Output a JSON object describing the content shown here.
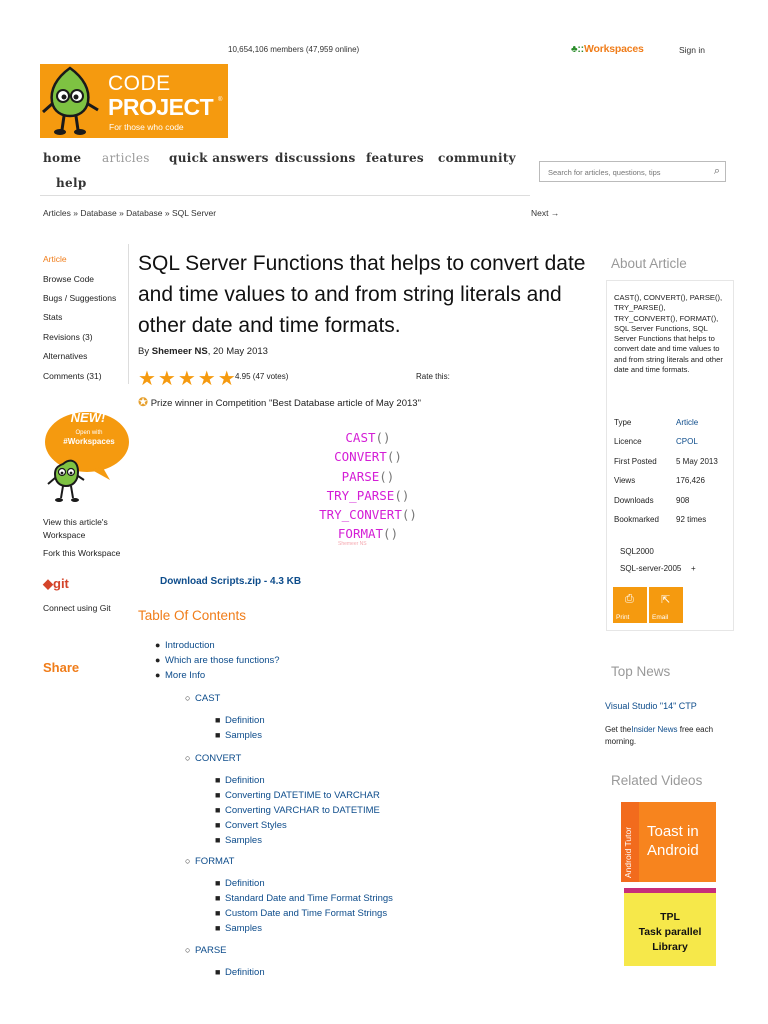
{
  "topbar": {
    "members": "10,654,106 members (47,959 online)",
    "workspaces": "Workspaces",
    "signin": "Sign in"
  },
  "logo": {
    "line1": "CODE",
    "line2": "PROJECT",
    "reg": "®",
    "tagline": "For those who code"
  },
  "nav": {
    "items": [
      "home",
      "articles",
      "quick answers",
      "discussions",
      "features",
      "community",
      "help"
    ]
  },
  "search": {
    "placeholder": "Search for articles, questions, tips"
  },
  "breadcrumb": {
    "text": "Articles » Database » Database » SQL Server",
    "next": "Next →"
  },
  "leftnav": {
    "items": [
      "Article",
      "Browse Code",
      "Bugs / Suggestions",
      "Stats",
      "Revisions (3)",
      "Alternatives",
      "Comments (31)"
    ],
    "ws_badge_new": "NEW!",
    "ws_badge_open": "Open with",
    "ws_badge_name": "#Workspaces",
    "view_ws_1": "View this article's",
    "view_ws_2": "Workspace",
    "fork_ws": "Fork this Workspace",
    "git": "git",
    "connect_git": "Connect using Git",
    "share": "Share"
  },
  "article": {
    "title": "SQL Server Functions that helps to convert date and time values to and from string literals and other date and time formats.",
    "by": "By",
    "author": "Shemeer NS",
    "date": ", 20 May 2013",
    "stars": "★★★★★",
    "rating": "4.95 (47 votes)",
    "rate_this": "Rate this:",
    "prize": "Prize winner in Competition \"Best Database article of May 2013\"",
    "functions": [
      "CAST",
      "CONVERT",
      "PARSE",
      "TRY_PARSE",
      "TRY_CONVERT",
      "FORMAT"
    ],
    "paren": "()",
    "watermark": "Shemeer NS",
    "download": "Download Scripts.zip - 4.3 KB",
    "toc_title": "Table Of Contents",
    "toc": {
      "l1": [
        "Introduction",
        "Which are those functions?",
        "More Info"
      ],
      "cast": "CAST",
      "cast_items": [
        "Definition",
        "Samples"
      ],
      "convert": "CONVERT",
      "convert_items": [
        "Definition",
        "Converting DATETIME to VARCHAR",
        "Converting VARCHAR to DATETIME",
        "Convert Styles",
        "Samples"
      ],
      "format": "FORMAT",
      "format_items": [
        "Definition",
        "Standard Date and Time Format Strings",
        "Custom Date and Time Format Strings",
        "Samples"
      ],
      "parse": "PARSE",
      "parse_items": [
        "Definition"
      ]
    }
  },
  "about": {
    "heading": "About Article",
    "description": "CAST(), CONVERT(), PARSE(), TRY_PARSE(), TRY_CONVERT(), FORMAT(), SQL Server Functions, SQL Server Functions that helps to convert date and time values to and from string literals and other date and time formats.",
    "meta": [
      {
        "k": "Type",
        "v": "Article"
      },
      {
        "k": "Licence",
        "v": "CPOL"
      },
      {
        "k": "First Posted",
        "v": "5 May 2013"
      },
      {
        "k": "Views",
        "v": "176,426"
      },
      {
        "k": "Downloads",
        "v": "908"
      },
      {
        "k": "Bookmarked",
        "v": "92 times"
      }
    ],
    "tags": [
      "SQL2000",
      "SQL-server-2005"
    ],
    "tag_more": "+",
    "print": "Print",
    "email": "Email"
  },
  "news": {
    "heading": "Top News",
    "link": "Visual Studio \"14\" CTP",
    "insider_pre": "Get the",
    "insider_link": "Insider News",
    "insider_post": " free each morning."
  },
  "videos": {
    "heading": "Related Videos",
    "v1_side": "Android Tutor",
    "v1_line1": "Toast in",
    "v1_line2": "Android",
    "v2_line1": "TPL",
    "v2_line2": "Task parallel",
    "v2_line3": "Library"
  },
  "colors": {
    "accent_orange": "#f59a0f",
    "link_blue": "#0d4c8b",
    "func_magenta": "#d41ed6"
  }
}
